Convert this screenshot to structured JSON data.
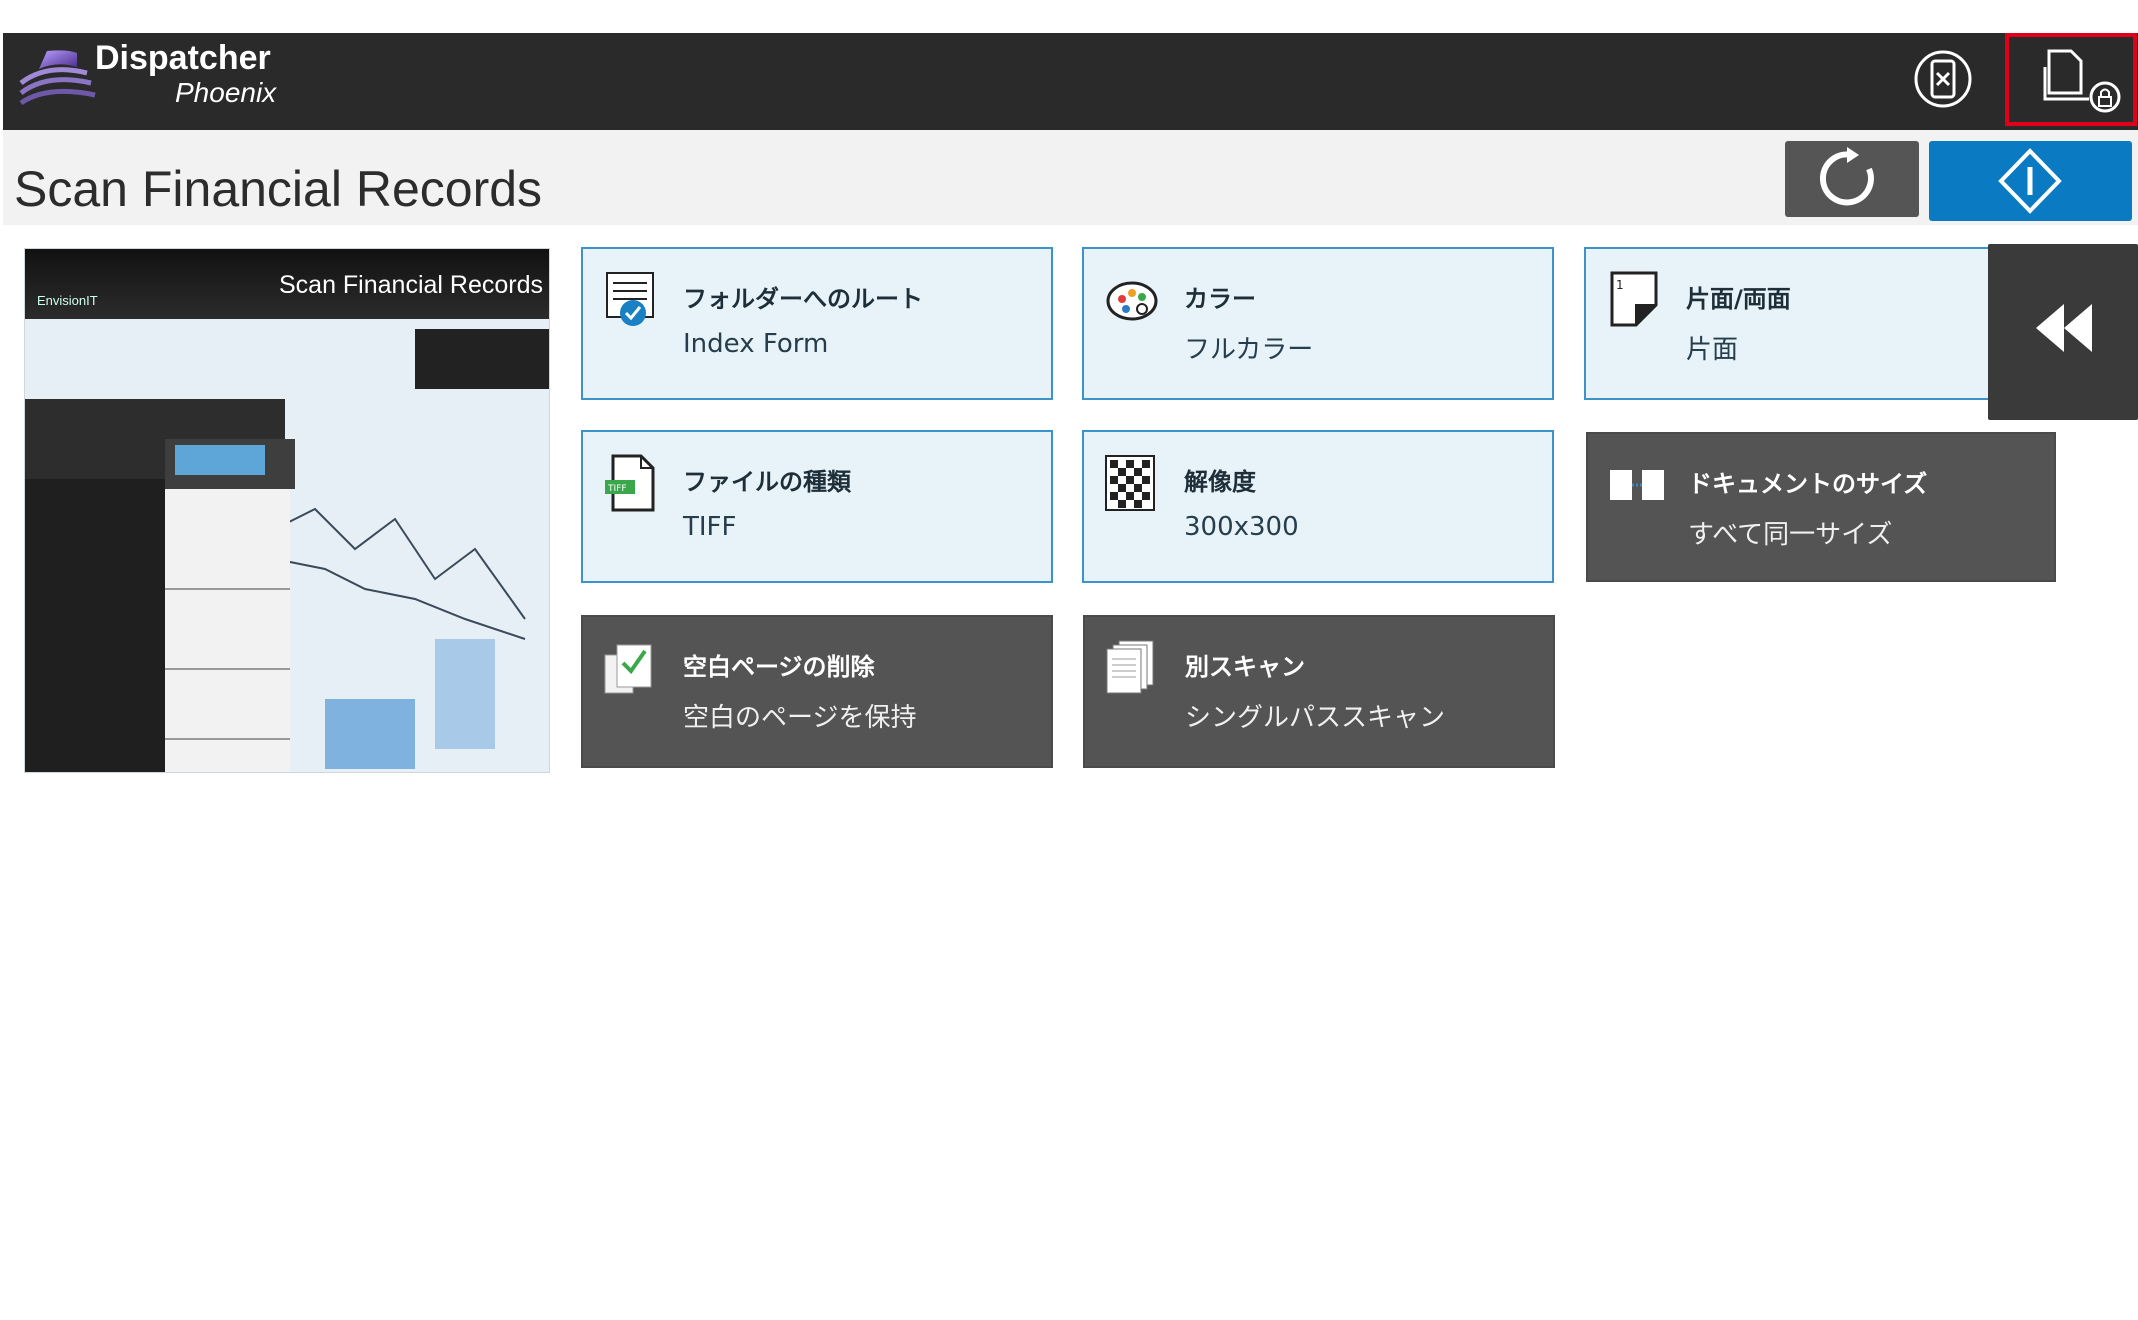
{
  "header": {
    "brand_title": "Dispatcher",
    "brand_subtitle": "Phoenix"
  },
  "page": {
    "title": "Scan Financial Records"
  },
  "preview": {
    "caption": "Scan Financial Records",
    "brand": "EnvisionIT"
  },
  "settings": [
    {
      "label": "フォルダーへのルート",
      "value": "Index Form",
      "icon": "index-form-icon"
    },
    {
      "label": "カラー",
      "value": "フルカラー",
      "icon": "palette-icon"
    },
    {
      "label": "片面/両面",
      "value": "片面",
      "icon": "simplex-page-icon"
    },
    {
      "label": "ファイルの種類",
      "value": "TIFF",
      "icon": "tiff-file-icon"
    },
    {
      "label": "解像度",
      "value": "300x300",
      "icon": "resolution-checker-icon"
    },
    {
      "label": "ドキュメントのサイズ",
      "value": "すべて同一サイズ",
      "icon": "document-size-icon"
    },
    {
      "label": "空白ページの削除",
      "value": "空白のページを保持",
      "icon": "blank-page-check-icon"
    },
    {
      "label": "別スキャン",
      "value": "シングルパススキャン",
      "icon": "separate-scan-icon"
    }
  ],
  "colors": {
    "header_bg": "#2a2a2a",
    "title_bg": "#f2f2f2",
    "start_button": "#0a7bc2",
    "reset_button": "#555555",
    "active_card_bg": "#e7f3f8",
    "active_card_border": "#3c93c9",
    "inactive_card_bg": "#545454",
    "highlight_border": "#e0001a"
  }
}
